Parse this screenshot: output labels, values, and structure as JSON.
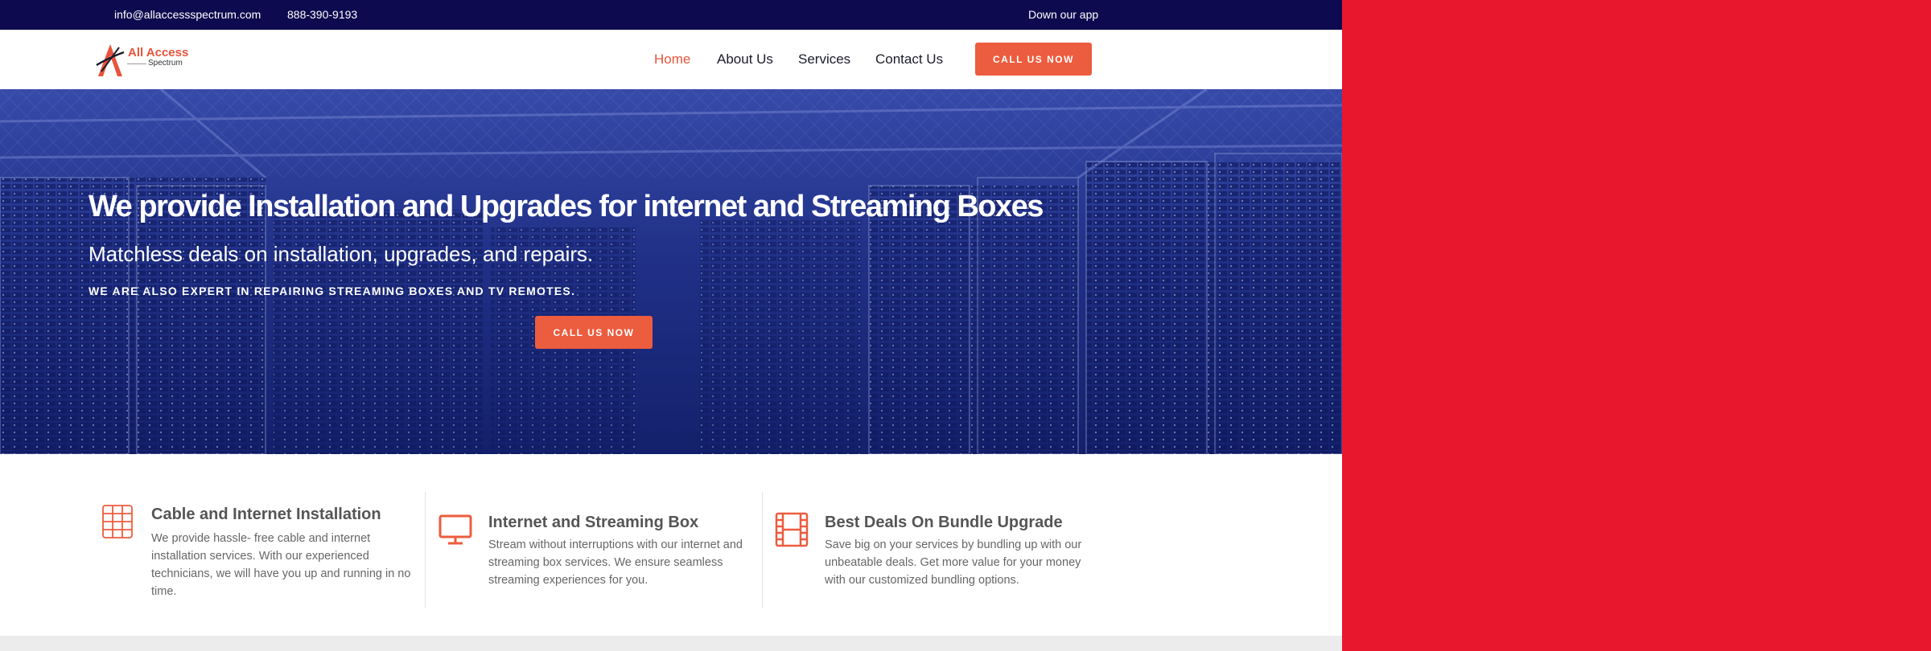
{
  "topbar": {
    "email": "info@allaccessspectrum.com",
    "phone": "888-390-9193",
    "app_link": "Down our app"
  },
  "logo": {
    "name_line1": "All Access",
    "name_line2": "Spectrum"
  },
  "nav": {
    "items": [
      {
        "label": "Home",
        "active": true
      },
      {
        "label": "About Us",
        "active": false
      },
      {
        "label": "Services",
        "active": false
      },
      {
        "label": "Contact Us",
        "active": false
      }
    ],
    "cta_label": "CALL US NOW"
  },
  "hero": {
    "headline": "We provide Installation and Upgrades for internet and Streaming Boxes",
    "subheadline": "Matchless deals on installation, upgrades, and repairs.",
    "tagline": "WE ARE ALSO EXPERT IN REPAIRING STREAMING BOXES AND TV REMOTES.",
    "cta_label": "CALL US NOW"
  },
  "features": [
    {
      "icon": "server-rack-icon",
      "title": "Cable and Internet Installation",
      "description": "We provide hassle- free cable and internet installation services. With our experienced technicians, we will have you up and running in no time."
    },
    {
      "icon": "monitor-icon",
      "title": "Internet and Streaming Box",
      "description": "Stream without interruptions with our internet and streaming box services. We ensure seamless streaming experiences for you."
    },
    {
      "icon": "film-strip-icon",
      "title": "Best Deals On Bundle Upgrade",
      "description": "Save big on your services by bundling up with our unbeatable deals. Get more value for your money with our customized bundling options."
    }
  ],
  "colors": {
    "topbar_bg": "#0e0a4f",
    "accent": "#ec5c3e",
    "side_panel": "#e8172e"
  }
}
